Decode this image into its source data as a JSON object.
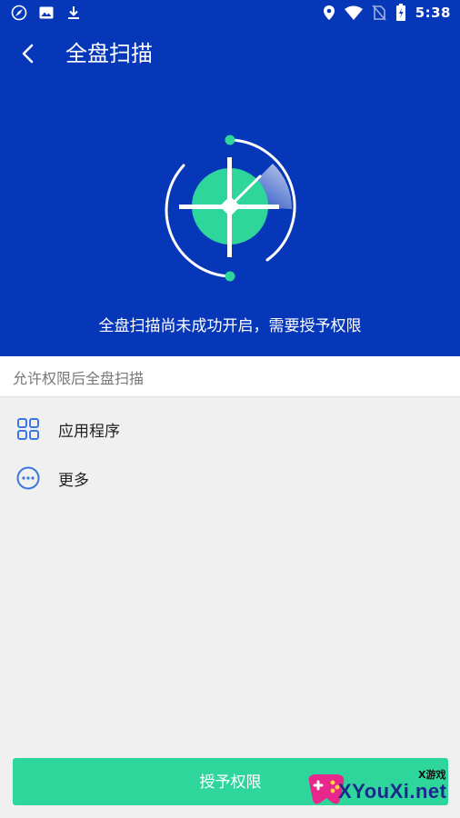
{
  "status_bar": {
    "time": "5:38",
    "left_icons": [
      "compass-icon",
      "image-icon",
      "download-icon"
    ],
    "right_icons": [
      "location-icon",
      "wifi-icon",
      "no-sim-icon",
      "battery-icon"
    ]
  },
  "header": {
    "back_icon": "chevron-left-icon",
    "title": "全盘扫描"
  },
  "hero": {
    "message": "全盘扫描尚未成功开启，需要授予权限"
  },
  "section": {
    "header": "允许权限后全盘扫描"
  },
  "list": [
    {
      "label": "应用程序",
      "icon": "apps-grid-icon"
    },
    {
      "label": "更多",
      "icon": "more-circle-icon"
    }
  ],
  "grant_button": {
    "label": "授予权限"
  },
  "watermark": {
    "small": "X游戏",
    "text": "XYouXi.net"
  },
  "colors": {
    "hero_bg": "#0537b8",
    "accent_green": "#2ed69b",
    "page_bg": "#f0f0f0"
  }
}
